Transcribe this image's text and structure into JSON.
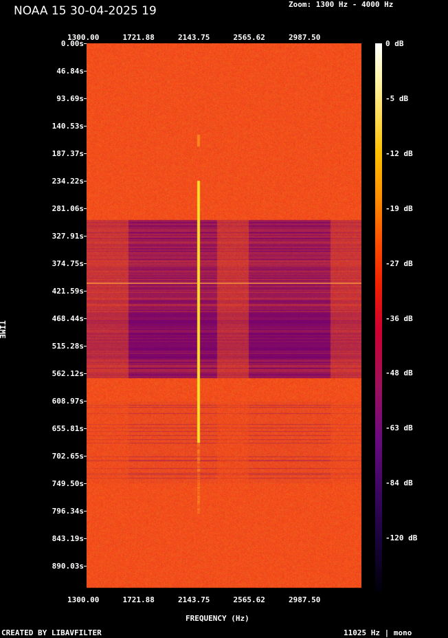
{
  "title": "NOAA 15 30-04-2025 19",
  "zoom": "Zoom: 1300 Hz - 4000 Hz",
  "footer_left": "CREATED BY LIBAVFILTER",
  "footer_right": "11025 Hz | mono",
  "chart_data": {
    "type": "heatmap",
    "xlabel": "FREQUENCY (Hz)",
    "ylabel": "TIME",
    "x_ticks": [
      "1300.00",
      "1721.88",
      "2143.75",
      "2565.62",
      "2987.50"
    ],
    "y_ticks": [
      "0.00s",
      "46.84s",
      "93.69s",
      "140.53s",
      "187.37s",
      "234.22s",
      "281.06s",
      "327.91s",
      "374.75s",
      "421.59s",
      "468.44s",
      "515.28s",
      "562.12s",
      "608.97s",
      "655.81s",
      "702.65s",
      "749.50s",
      "796.34s",
      "843.19s",
      "890.03s"
    ],
    "colorbar_ticks": [
      "0 dB",
      "-5 dB",
      "-12 dB",
      "-19 dB",
      "-27 dB",
      "-36 dB",
      "-48 dB",
      "-63 dB",
      "-84 dB",
      "-120 dB"
    ],
    "xlim": [
      1300,
      4000
    ],
    "ylim": [
      0,
      936.87
    ],
    "signal_frequency_hz": 2400,
    "signal_time_range_s": [
      140,
      800
    ],
    "weak_band_time_range_s": [
      300,
      570
    ]
  }
}
